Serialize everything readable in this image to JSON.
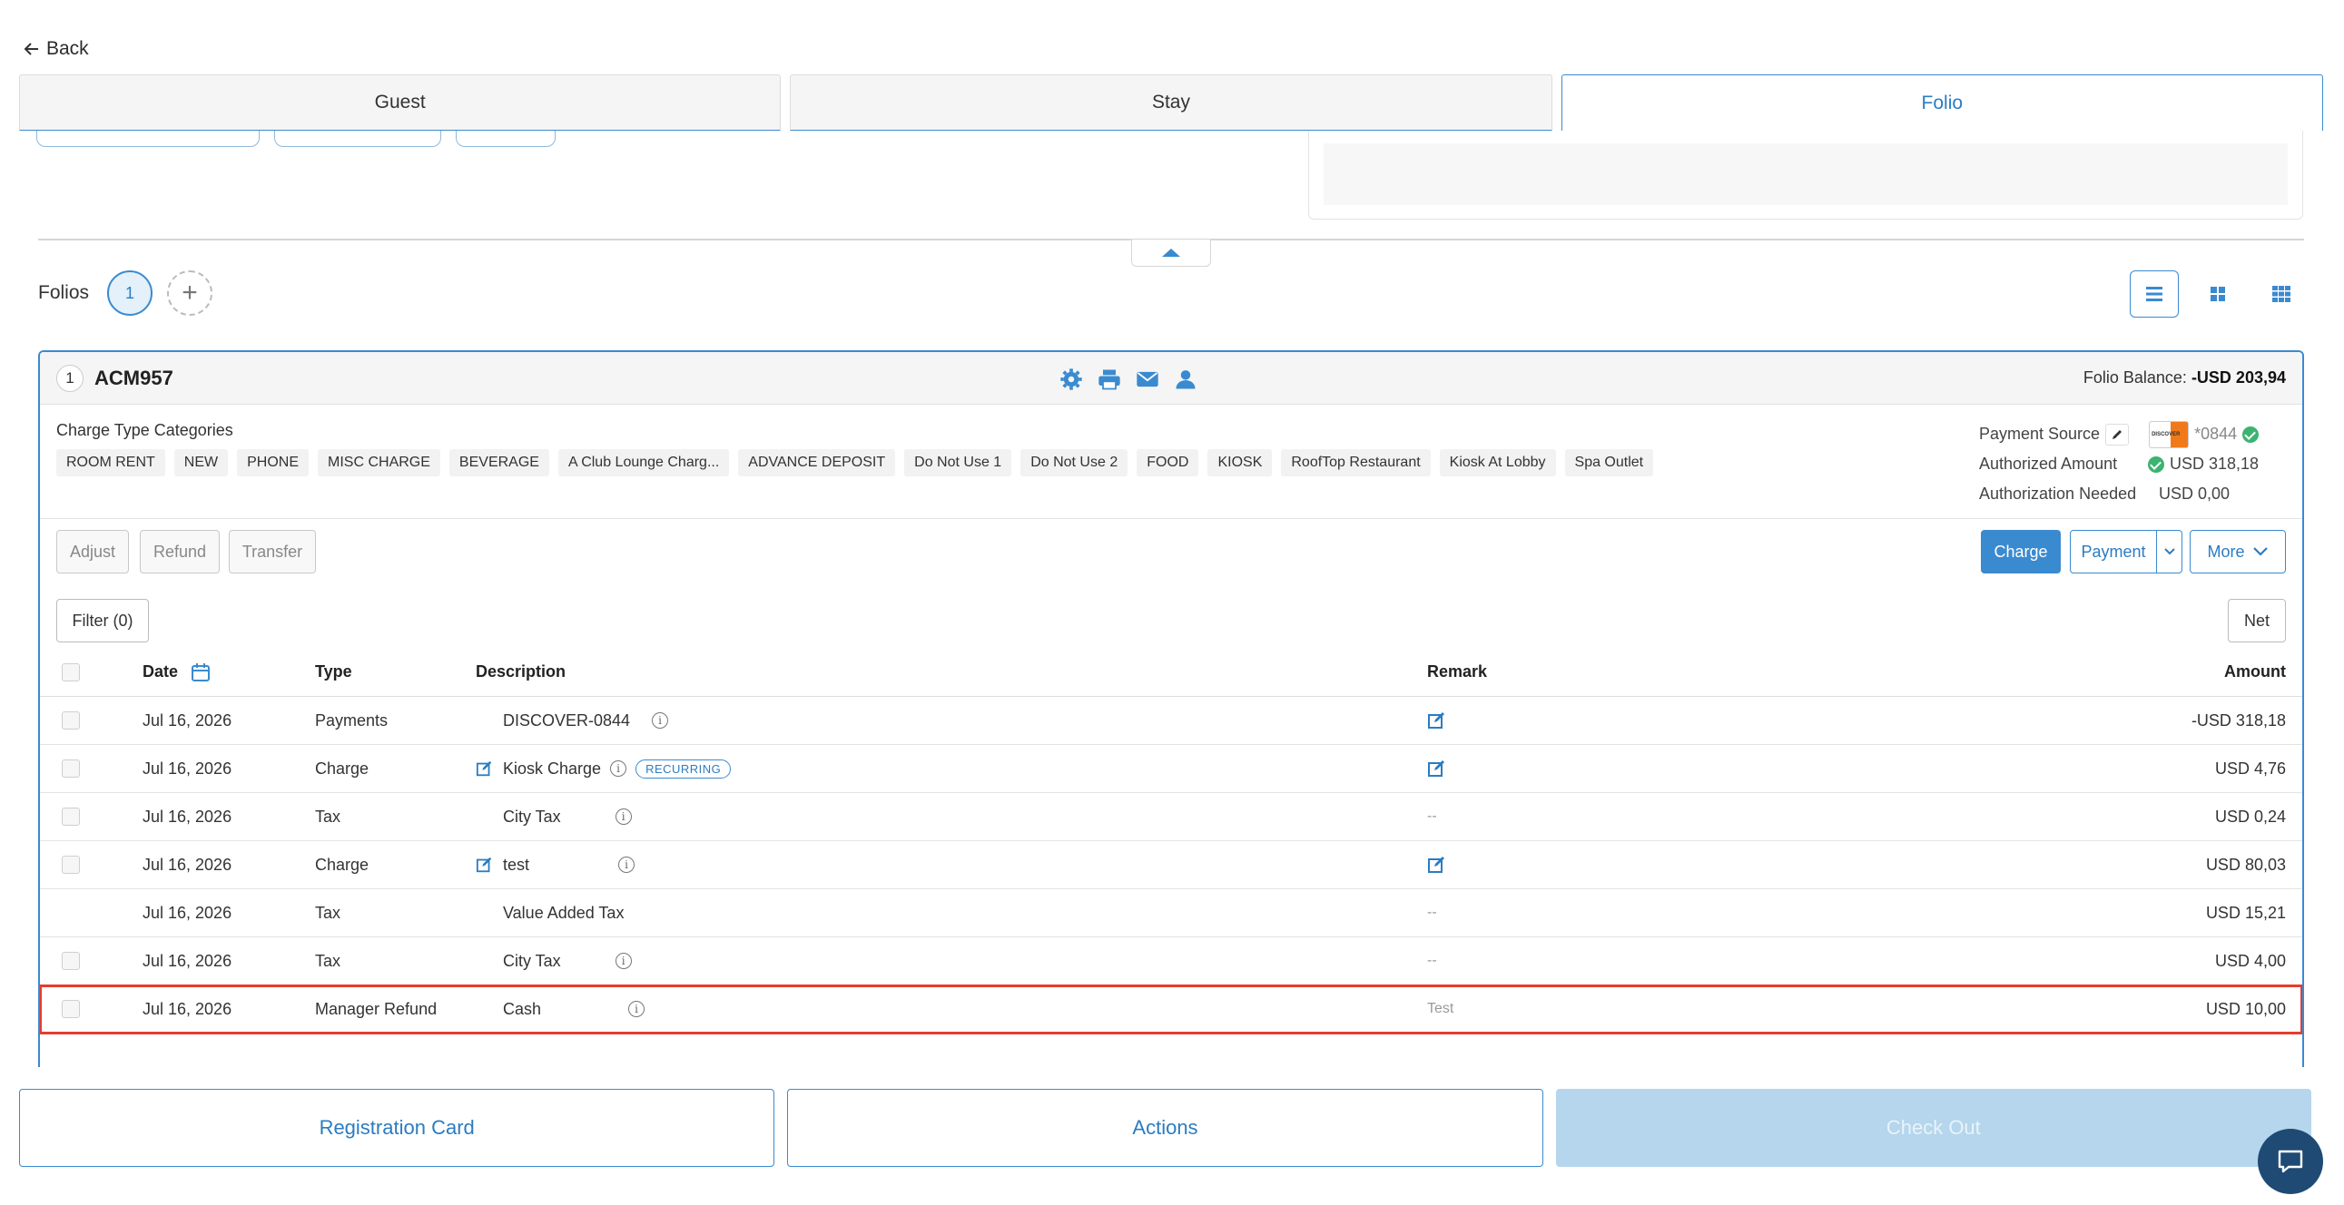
{
  "back_label": "Back",
  "tabs": [
    {
      "label": "Guest",
      "active": false
    },
    {
      "label": "Stay",
      "active": false
    },
    {
      "label": "Folio",
      "active": true
    }
  ],
  "folios": {
    "label": "Folios",
    "current": "1",
    "add_icon": "plus-icon"
  },
  "view_toggles": [
    "list-view-icon",
    "grid-2-view-icon",
    "grid-3-view-icon"
  ],
  "folio": {
    "index": "1",
    "name": "ACM957",
    "icons": [
      "gear-icon",
      "printer-icon",
      "mail-icon",
      "person-icon"
    ],
    "balance_label": "Folio Balance:",
    "balance_value": "-USD 203,94",
    "categories_title": "Charge Type Categories",
    "categories": [
      "ROOM RENT",
      "NEW",
      "PHONE",
      "MISC CHARGE",
      "BEVERAGE",
      "A Club Lounge Charg...",
      "ADVANCE DEPOSIT",
      "Do Not Use 1",
      "Do Not Use 2",
      "FOOD",
      "KIOSK",
      "RoofTop Restaurant",
      "Kiosk At Lobby",
      "Spa Outlet"
    ],
    "payment_source_label": "Payment Source",
    "payment_source_card": "*0844",
    "card_brand_text": "DISCOVER",
    "authorized_label": "Authorized Amount",
    "authorized_value": "USD 318,18",
    "auth_needed_label": "Authorization Needed",
    "auth_needed_value": "USD 0,00"
  },
  "actions": {
    "adjust": "Adjust",
    "refund": "Refund",
    "transfer": "Transfer",
    "charge": "Charge",
    "payment": "Payment",
    "more": "More",
    "filter": "Filter (0)",
    "net": "Net"
  },
  "table": {
    "headers": {
      "date": "Date",
      "type": "Type",
      "description": "Description",
      "remark": "Remark",
      "amount": "Amount"
    },
    "rows": [
      {
        "date": "Jul 16, 2026",
        "type": "Payments",
        "description": "DISCOVER-0844",
        "remark": "",
        "amount": "-USD 318,18"
      },
      {
        "date": "Jul 16, 2026",
        "type": "Charge",
        "description": "Kiosk Charge",
        "badge": "RECURRING",
        "remark": "",
        "amount": "USD 4,76"
      },
      {
        "date": "Jul 16, 2026",
        "type": "Tax",
        "description": "City Tax",
        "remark": "--",
        "amount": "USD 0,24"
      },
      {
        "date": "Jul 16, 2026",
        "type": "Charge",
        "description": "test",
        "remark": "",
        "amount": "USD 80,03"
      },
      {
        "date": "Jul 16, 2026",
        "type": "Tax",
        "description": "Value Added Tax",
        "remark": "--",
        "amount": "USD 15,21"
      },
      {
        "date": "Jul 16, 2026",
        "type": "Tax",
        "description": "City Tax",
        "remark": "--",
        "amount": "USD 4,00"
      },
      {
        "date": "Jul 16, 2026",
        "type": "Manager Refund",
        "description": "Cash",
        "remark": "Test",
        "amount": "USD 10,00"
      }
    ]
  },
  "footer": {
    "registration_card": "Registration Card",
    "actions": "Actions",
    "check_out": "Check Out"
  },
  "colors": {
    "accent": "#3a8ad0",
    "highlight": "#e53d2e",
    "disabled": "#b5d6ec"
  }
}
